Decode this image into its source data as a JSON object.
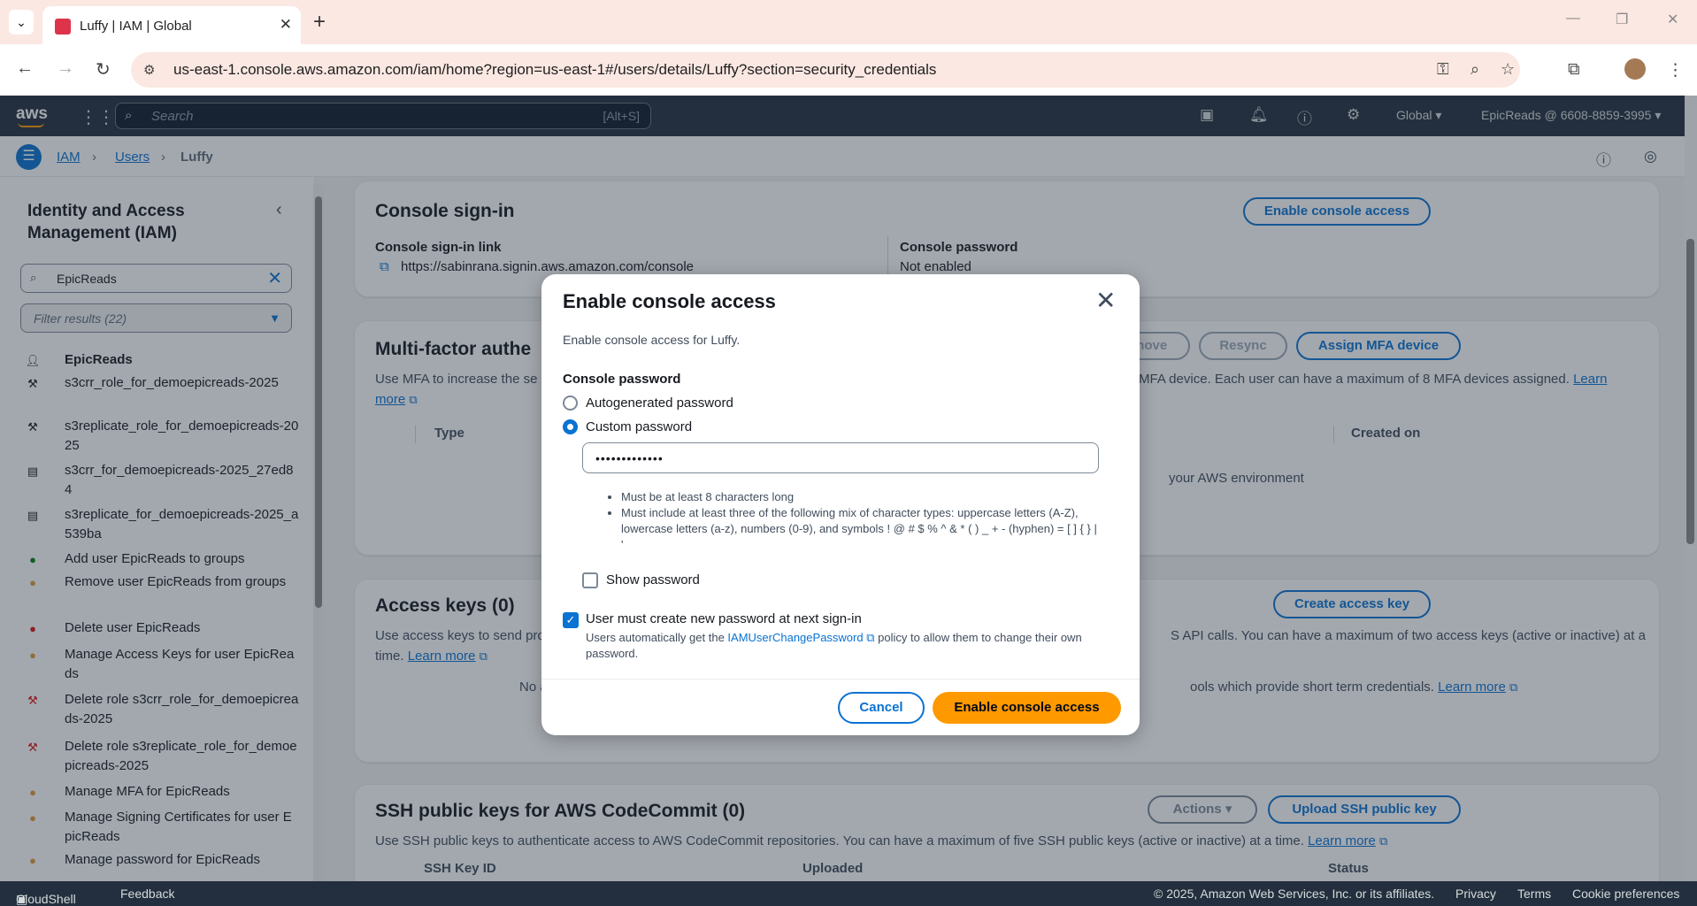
{
  "browser": {
    "tab_title": "Luffy | IAM | Global",
    "url": "us-east-1.console.aws.amazon.com/iam/home?region=us-east-1#/users/details/Luffy?section=security_credentials"
  },
  "aws_header": {
    "logo": "aws",
    "search_placeholder": "Search",
    "search_shortcut": "[Alt+S]",
    "region": "Global",
    "account": "EpicReads @ 6608-8859-3995"
  },
  "breadcrumb": [
    "IAM",
    "Users",
    "Luffy"
  ],
  "sidebar": {
    "title": "Identity and Access Management (IAM)",
    "search_value": "EpicReads",
    "filter_placeholder": "Filter results (22)",
    "results": [
      {
        "icon": "user-icon",
        "color": "#414d5c",
        "text": "EpicReads"
      },
      {
        "icon": "role-icon",
        "color": "#414d5c",
        "text": "s3crr_role_for_demoepicreads-2025"
      },
      {
        "icon": "role-icon",
        "color": "#414d5c",
        "text": "s3replicate_role_for_demoepicreads-2025"
      },
      {
        "icon": "policy-icon",
        "color": "#414d5c",
        "text": "s3crr_for_demoepicreads-2025_27ed84"
      },
      {
        "icon": "policy-icon",
        "color": "#414d5c",
        "text": "s3replicate_for_demoepicreads-2025_a539ba"
      },
      {
        "icon": "user-icon",
        "color": "#037f0c",
        "text": "Add user EpicReads to groups"
      },
      {
        "icon": "user-icon",
        "color": "#df9b3a",
        "text": "Remove user EpicReads from groups"
      },
      {
        "icon": "user-icon",
        "color": "#d91515",
        "text": "Delete user EpicReads"
      },
      {
        "icon": "user-icon",
        "color": "#df9b3a",
        "text": "Manage Access Keys for user EpicReads"
      },
      {
        "icon": "role-icon",
        "color": "#d91515",
        "text": "Delete role s3crr_role_for_demoepicreads-2025"
      },
      {
        "icon": "role-icon",
        "color": "#d91515",
        "text": "Delete role s3replicate_role_for_demoepicreads-2025"
      },
      {
        "icon": "user-icon",
        "color": "#df9b3a",
        "text": "Manage MFA for EpicReads"
      },
      {
        "icon": "user-icon",
        "color": "#df9b3a",
        "text": "Manage Signing Certificates for user EpicReads"
      },
      {
        "icon": "user-icon",
        "color": "#df9b3a",
        "text": "Manage password for EpicReads"
      }
    ]
  },
  "console_signin": {
    "title": "Console sign-in",
    "enable_button": "Enable console access",
    "link_label": "Console sign-in link",
    "link_value": "https://sabinrana.signin.aws.amazon.com/console",
    "password_label": "Console password",
    "password_value": "Not enabled"
  },
  "mfa": {
    "title": "Multi-factor authe",
    "remove": "Remove",
    "resync": "Resync",
    "assign": "Assign MFA device",
    "desc_left": "Use MFA to increase the se",
    "desc_right": "MFA device. Each user can have a maximum of 8 MFA devices assigned.",
    "learn": "Learn",
    "more": "more",
    "col_type": "Type",
    "col_created": "Created on",
    "empty_right": "your AWS environment"
  },
  "access_keys": {
    "title": "Access keys (0)",
    "create_button": "Create access key",
    "desc_left": "Use access keys to send pro",
    "desc_right": "S API calls. You can have a maximum of two access keys (active or inactive) at a",
    "desc_line2": "time.",
    "learn_more": "Learn more",
    "empty_left": "No a",
    "empty_right": "ools which provide short term credentials."
  },
  "ssh": {
    "title": "SSH public keys for AWS CodeCommit (0)",
    "actions": "Actions",
    "upload": "Upload SSH public key",
    "desc": "Use SSH public keys to authenticate access to AWS CodeCommit repositories. You can have a maximum of five SSH public keys (active or inactive) at a time.",
    "learn_more": "Learn more",
    "col_id": "SSH Key ID",
    "col_uploaded": "Uploaded",
    "col_status": "Status"
  },
  "modal": {
    "title": "Enable console access",
    "subtitle": "Enable console access for Luffy.",
    "password_label": "Console password",
    "opt_auto": "Autogenerated password",
    "opt_custom": "Custom password",
    "password_masked": "•••••••••••••",
    "rule1": "Must be at least 8 characters long",
    "rule2": "Must include at least three of the following mix of character types: uppercase letters (A-Z), lowercase letters (a-z), numbers (0-9), and symbols ! @ # $ % ^ & * ( ) _ + - (hyphen) = [ ] { } | '",
    "show_password": "Show password",
    "must_change": "User must create new password at next sign-in",
    "must_change_desc_pre": "Users automatically get the",
    "policy_link": "IAMUserChangePassword",
    "must_change_desc_post": "policy to allow them to change their own password.",
    "cancel": "Cancel",
    "primary": "Enable console access"
  },
  "footer": {
    "cloudshell": "CloudShell",
    "feedback": "Feedback",
    "copyright": "© 2025, Amazon Web Services, Inc. or its affiliates.",
    "privacy": "Privacy",
    "terms": "Terms",
    "cookies": "Cookie preferences"
  }
}
